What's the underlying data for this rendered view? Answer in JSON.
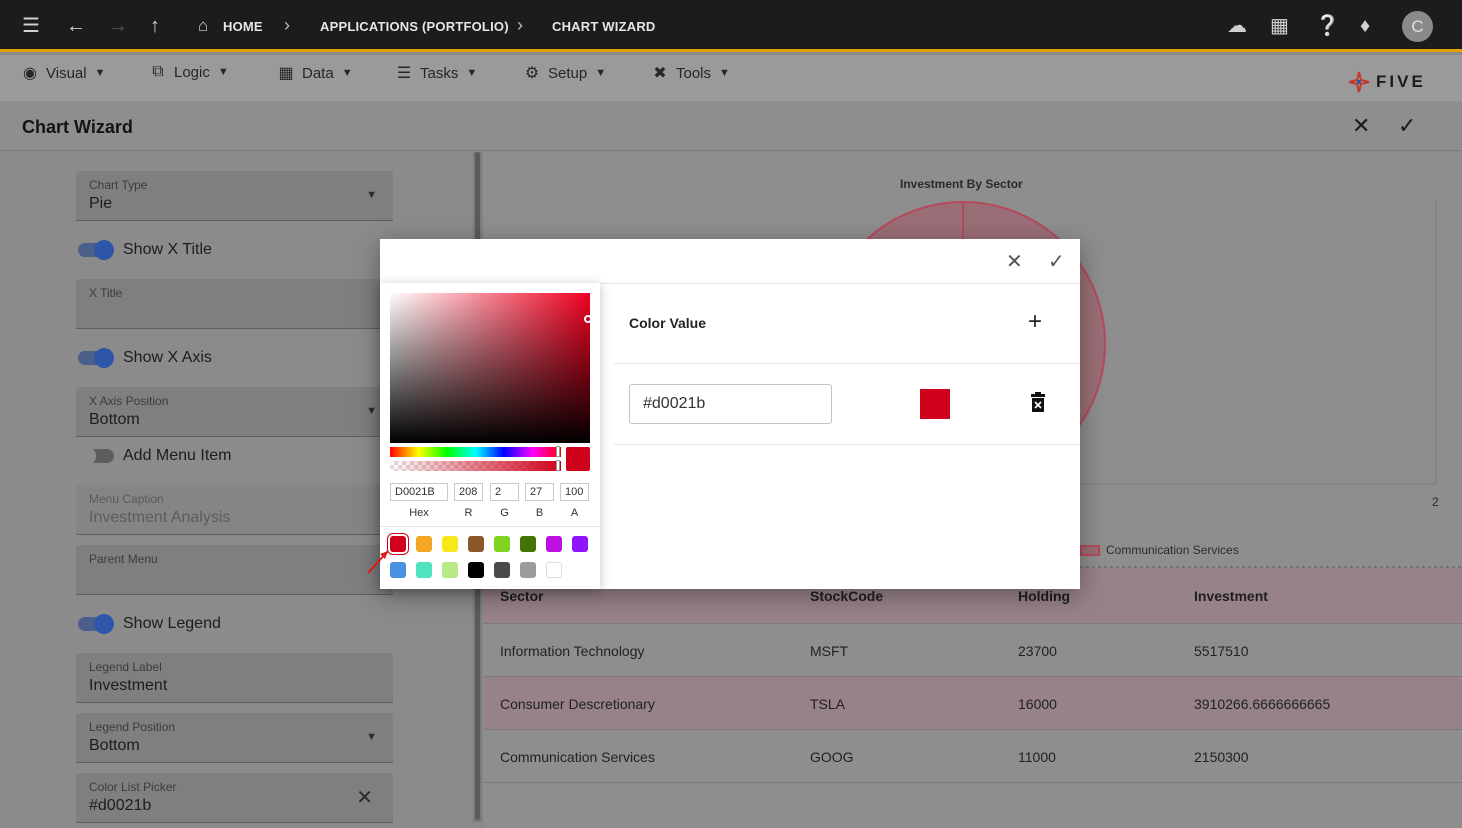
{
  "topbar": {
    "breadcrumbs": [
      "HOME",
      "APPLICATIONS (PORTFOLIO)",
      "CHART WIZARD"
    ],
    "avatar_letter": "C",
    "icons": [
      "hamburger-icon",
      "back-arrow-icon",
      "forward-arrow-icon",
      "up-arrow-icon",
      "home-icon",
      "cloud-check-icon",
      "library-icon",
      "help-icon",
      "bell-icon"
    ]
  },
  "menubar": {
    "items": [
      {
        "label": "Visual",
        "icon": "eye-icon"
      },
      {
        "label": "Logic",
        "icon": "logic-icon"
      },
      {
        "label": "Data",
        "icon": "table-icon"
      },
      {
        "label": "Tasks",
        "icon": "tasks-icon"
      },
      {
        "label": "Setup",
        "icon": "gear-icon"
      },
      {
        "label": "Tools",
        "icon": "tools-icon"
      }
    ],
    "logo_text": "FIVE"
  },
  "page": {
    "title": "Chart Wizard"
  },
  "form": {
    "chart_type": {
      "label": "Chart Type",
      "value": "Pie"
    },
    "show_x_title": {
      "label": "Show X Title",
      "on": true
    },
    "x_title": {
      "label": "X Title",
      "value": ""
    },
    "show_x_axis": {
      "label": "Show X Axis",
      "on": true
    },
    "x_axis_position": {
      "label": "X Axis Position",
      "value": "Bottom"
    },
    "add_menu_item": {
      "label": "Add Menu Item",
      "on": false
    },
    "menu_caption": {
      "label": "Menu Caption",
      "value": "Investment Analysis"
    },
    "parent_menu": {
      "label": "Parent Menu",
      "value": ""
    },
    "show_legend": {
      "label": "Show Legend",
      "on": true
    },
    "legend_label": {
      "label": "Legend Label",
      "value": "Investment"
    },
    "legend_position": {
      "label": "Legend Position",
      "value": "Bottom"
    },
    "color_list_picker": {
      "label": "Color List Picker",
      "value": "#d0021b"
    }
  },
  "chart_preview": {
    "title": "Investment By Sector",
    "axis_tick": "2",
    "legend_entry": "Communication Services"
  },
  "table": {
    "headers": [
      "Sector",
      "StockCode",
      "Holding",
      "Investment"
    ],
    "rows": [
      [
        "Information Technology",
        "MSFT",
        "23700",
        "5517510"
      ],
      [
        "Consumer Descretionary",
        "TSLA",
        "16000",
        "3910266.6666666665"
      ],
      [
        "Communication Services",
        "GOOG",
        "11000",
        "2150300"
      ]
    ]
  },
  "dialog": {
    "color_value_label": "Color Value",
    "hex_value": "#d0021b",
    "swatch_color": "#d0021b",
    "picker": {
      "hex": "D0021B",
      "r": "208",
      "g": "2",
      "b": "27",
      "a": "100",
      "labels": [
        "Hex",
        "R",
        "G",
        "B",
        "A"
      ],
      "preset_colors": [
        "#d0021b",
        "#f5a623",
        "#f8e71c",
        "#8b572a",
        "#7ed321",
        "#417505",
        "#bd10e0",
        "#9013fe",
        "#4a90e2",
        "#50e3c2",
        "#b8e986",
        "#000000",
        "#4a4a4a",
        "#9b9b9b",
        "#ffffff"
      ]
    }
  }
}
